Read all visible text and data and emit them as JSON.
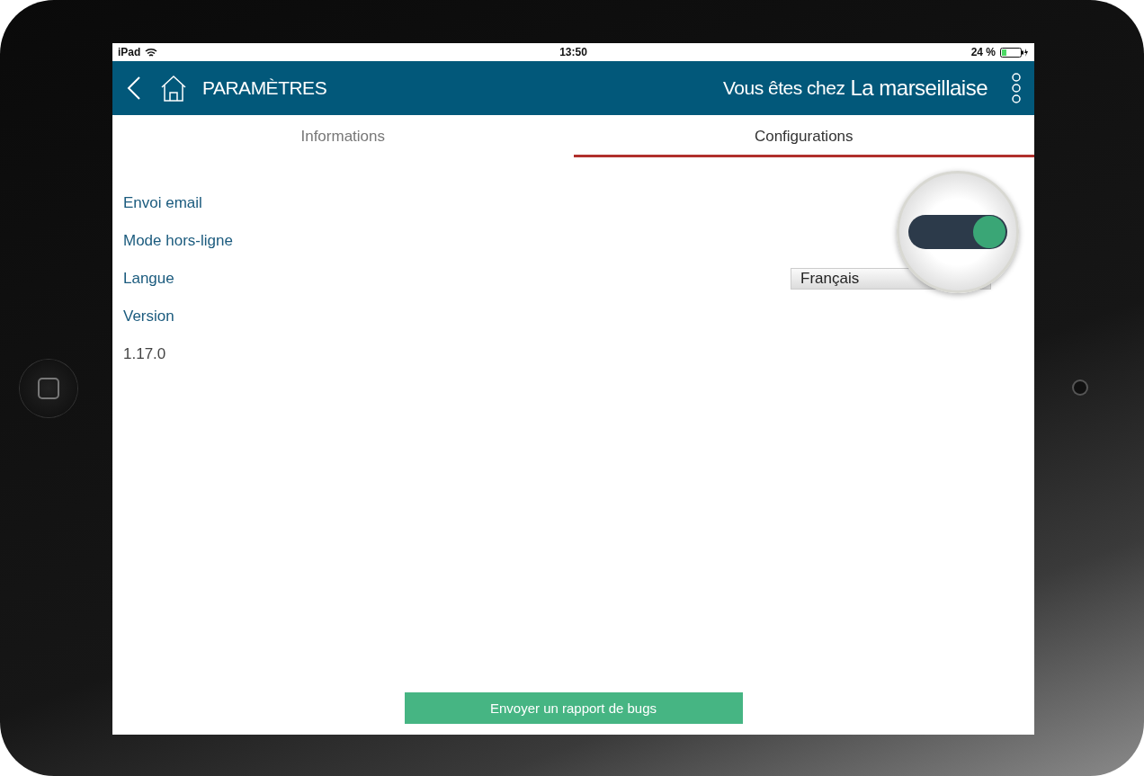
{
  "status_bar": {
    "device": "iPad",
    "time": "13:50",
    "battery": "24 %"
  },
  "header": {
    "title": "PARAMÈTRES",
    "greeting": "Vous êtes chez",
    "place": "La marseillaise"
  },
  "tabs": [
    {
      "label": "Informations",
      "selected": false
    },
    {
      "label": "Configurations",
      "selected": true
    }
  ],
  "settings": [
    {
      "kind": "label",
      "label": "Envoi email"
    },
    {
      "kind": "toggle",
      "label": "Mode hors-ligne",
      "on": true
    },
    {
      "kind": "select",
      "label": "Langue",
      "value": "Français"
    },
    {
      "kind": "label",
      "label": "Version"
    },
    {
      "kind": "value",
      "label": "1.17.0"
    }
  ],
  "bug_button": "Envoyer un rapport de bugs"
}
